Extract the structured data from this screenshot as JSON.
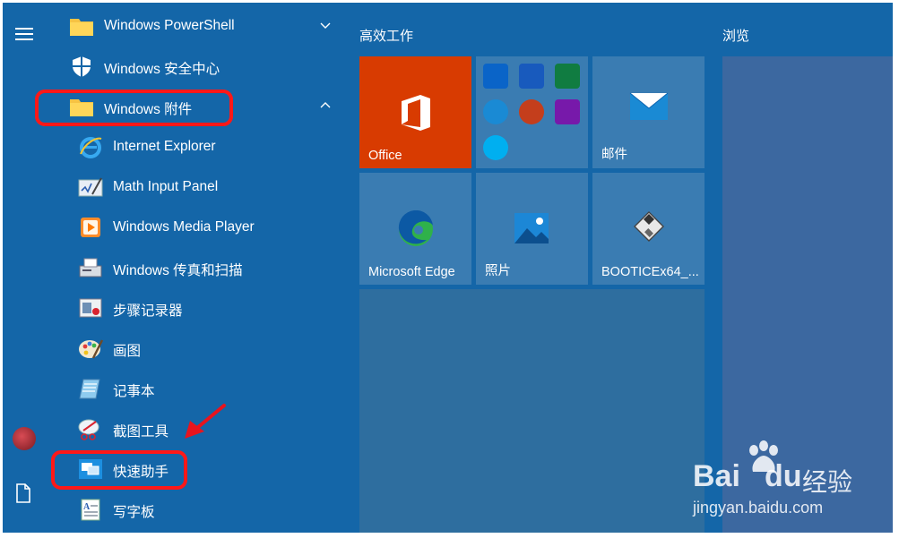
{
  "menu_button": "hamburger-menu",
  "app_list": [
    {
      "label": "Windows PowerShell",
      "icon": "folder-icon",
      "expanded": false
    },
    {
      "label": "Windows 安全中心",
      "icon": "shield-icon"
    },
    {
      "label": "Windows 附件",
      "icon": "folder-icon",
      "expanded": true
    },
    {
      "label": "Internet Explorer",
      "icon": "internet-explorer-icon"
    },
    {
      "label": "Math Input Panel",
      "icon": "math-input-panel-icon"
    },
    {
      "label": "Windows Media Player",
      "icon": "media-player-icon"
    },
    {
      "label": "Windows 传真和扫描",
      "icon": "fax-scan-icon"
    },
    {
      "label": "步骤记录器",
      "icon": "steps-recorder-icon"
    },
    {
      "label": "画图",
      "icon": "paint-icon"
    },
    {
      "label": "记事本",
      "icon": "notepad-icon"
    },
    {
      "label": "截图工具",
      "icon": "snipping-tool-icon"
    },
    {
      "label": "快速助手",
      "icon": "quick-assist-icon"
    },
    {
      "label": "写字板",
      "icon": "wordpad-icon"
    }
  ],
  "tile_groups": {
    "productivity": {
      "title": "高效工作",
      "tiles": [
        {
          "label": "Office",
          "icon": "office-icon",
          "color": "#d83b01"
        },
        {
          "label": "",
          "icon": "office-apps-folder-icon"
        },
        {
          "label": "邮件",
          "icon": "mail-icon"
        },
        {
          "label": "Microsoft Edge",
          "icon": "edge-icon"
        },
        {
          "label": "照片",
          "icon": "photos-icon"
        },
        {
          "label": "BOOTICEx64_...",
          "icon": "floppy-disk-icon"
        }
      ]
    },
    "browse": {
      "title": "浏览"
    }
  },
  "watermark": {
    "brand": "Bai",
    "brand2": "du",
    "suffix": "经验",
    "url": "jingyan.baidu.com"
  },
  "colors": {
    "background": "#1466a8",
    "tile": "#3a7cb2",
    "office_tile": "#d83b01",
    "highlight": "#ff1818",
    "arrow": "#e8141e"
  }
}
